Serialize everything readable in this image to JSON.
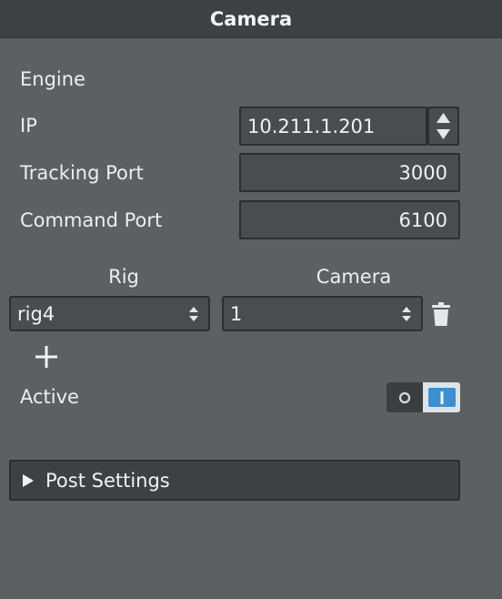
{
  "panel": {
    "title": "Camera"
  },
  "engine": {
    "heading": "Engine",
    "ip_label": "IP",
    "ip_value": "10.211.1.201",
    "tracking_port_label": "Tracking Port",
    "tracking_port_value": "3000",
    "command_port_label": "Command Port",
    "command_port_value": "6100"
  },
  "rig_table": {
    "rig_header": "Rig",
    "camera_header": "Camera",
    "rows": [
      {
        "rig": "rig4",
        "camera": "1"
      }
    ]
  },
  "active": {
    "label": "Active",
    "state": "on"
  },
  "post_settings": {
    "label": "Post Settings",
    "expanded": false
  },
  "colors": {
    "background": "#5d6063",
    "titlebar": "#3e4144",
    "toggle_accent": "#3d8fd3"
  },
  "icons": {
    "spinner": "up-down-spinner-icon",
    "select_arrows": "up-down-arrows-icon",
    "delete": "trash-icon",
    "add": "plus-icon",
    "expand": "triangle-right-icon"
  }
}
